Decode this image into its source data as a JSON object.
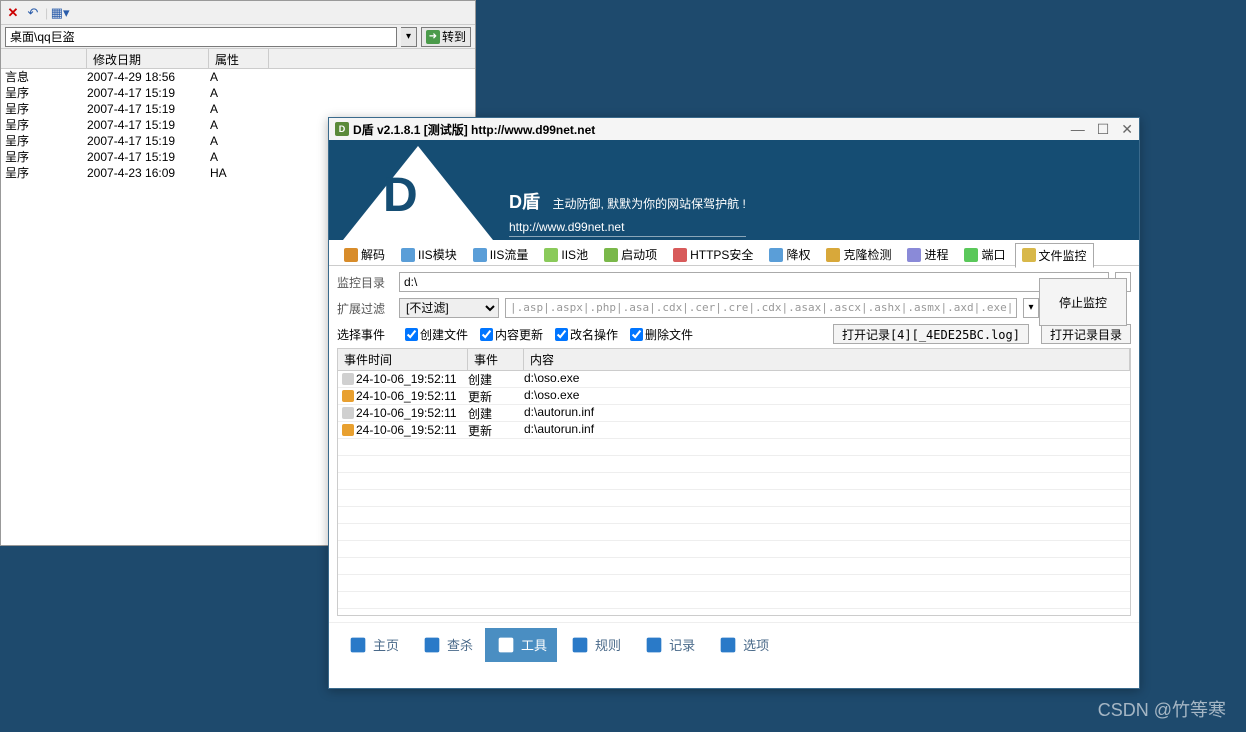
{
  "explorer": {
    "address": "桌面\\qq巨盗",
    "go_label": "转到",
    "col_modified": "修改日期",
    "col_attr": "属性",
    "rows": [
      {
        "name": "言息",
        "date": "2007-4-29 18:56",
        "attr": "A"
      },
      {
        "name": "呈序",
        "date": "2007-4-17 15:19",
        "attr": "A"
      },
      {
        "name": "呈序",
        "date": "2007-4-17 15:19",
        "attr": "A"
      },
      {
        "name": "呈序",
        "date": "2007-4-17 15:19",
        "attr": "A"
      },
      {
        "name": "呈序",
        "date": "2007-4-17 15:19",
        "attr": "A"
      },
      {
        "name": "呈序",
        "date": "2007-4-17 15:19",
        "attr": "A"
      },
      {
        "name": "呈序",
        "date": "2007-4-23 16:09",
        "attr": "HA"
      }
    ]
  },
  "dshield": {
    "title": "D盾 v2.1.8.1 [测试版] http://www.d99net.net",
    "banner_title": "D盾",
    "banner_sub": "主动防御, 默默为你的网站保驾护航 !",
    "banner_url": "http://www.d99net.net",
    "tabs": [
      "解码",
      "IIS模块",
      "IIS流量",
      "IIS池",
      "启动项",
      "HTTPS安全",
      "降权",
      "克隆检测",
      "进程",
      "端口",
      "文件监控"
    ],
    "form": {
      "dir_lbl": "监控目录",
      "dir_val": "d:\\",
      "ext_lbl": "扩展过滤",
      "ext_sel": "[不过滤]",
      "ext_list": "|.asp|.aspx|.php|.asa|.cdx|.cer|.cre|.cdx|.asax|.ascx|.ashx|.asmx|.axd|.exe|.dll|",
      "evt_lbl": "选择事件",
      "chk_create": "创建文件",
      "chk_update": "内容更新",
      "chk_rename": "改名操作",
      "chk_delete": "删除文件",
      "open_log": "打开记录[4][_4EDE25BC.log]",
      "open_dir": "打开记录目录",
      "stop": "停止监控"
    },
    "event_cols": {
      "time": "事件时间",
      "event": "事件",
      "content": "内容"
    },
    "events": [
      {
        "ico": "#d0d0d0",
        "time": "24-10-06_19:52:11",
        "event": "创建",
        "path": "d:\\oso.exe"
      },
      {
        "ico": "#e8a030",
        "time": "24-10-06_19:52:11",
        "event": "更新",
        "path": "d:\\oso.exe"
      },
      {
        "ico": "#d0d0d0",
        "time": "24-10-06_19:52:11",
        "event": "创建",
        "path": "d:\\autorun.inf"
      },
      {
        "ico": "#e8a030",
        "time": "24-10-06_19:52:11",
        "event": "更新",
        "path": "d:\\autorun.inf"
      }
    ],
    "bottom_nav": [
      "主页",
      "查杀",
      "工具",
      "规则",
      "记录",
      "选项"
    ]
  },
  "watermark": "CSDN @竹等寒"
}
